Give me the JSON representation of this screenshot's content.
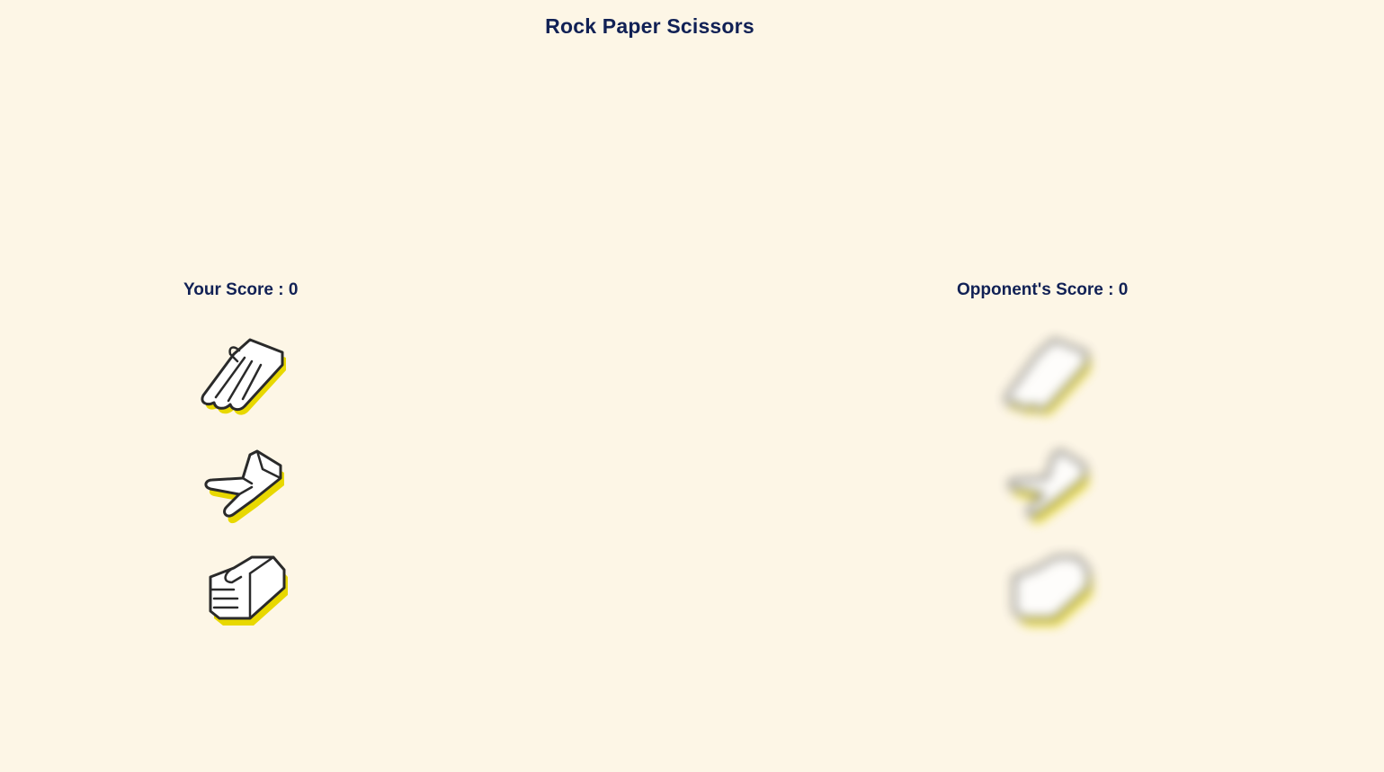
{
  "title": "Rock Paper Scissors",
  "player": {
    "score_label": "Your Score : 0",
    "choices": [
      {
        "name": "paper",
        "icon": "paper-hand-icon"
      },
      {
        "name": "scissors",
        "icon": "scissors-hand-icon"
      },
      {
        "name": "rock",
        "icon": "rock-hand-icon"
      }
    ]
  },
  "opponent": {
    "score_label": "Opponent's Score : 0",
    "choices": [
      {
        "name": "paper",
        "icon": "paper-hand-icon"
      },
      {
        "name": "scissors",
        "icon": "scissors-hand-icon"
      },
      {
        "name": "rock",
        "icon": "rock-hand-icon"
      }
    ]
  },
  "colors": {
    "background": "#fdf6e6",
    "text": "#112155",
    "shadow": "#e8d800",
    "outline": "#2a2a2a",
    "fill": "#ffffff"
  }
}
